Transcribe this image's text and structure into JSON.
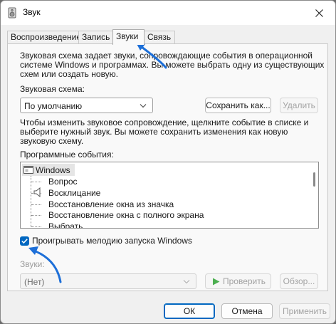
{
  "window": {
    "title": "Звук",
    "close_label": "×"
  },
  "tabs": [
    {
      "label": "Воспроизведение"
    },
    {
      "label": "Запись"
    },
    {
      "label": "Звуки"
    },
    {
      "label": "Связь"
    }
  ],
  "sounds": {
    "description_line1": "Звуковая схема задает звуки, сопровождающие события в операционной",
    "description_line2": "системе Windows и программах. Вы можете выбрать одну из существующих",
    "description_line3": "схем или создать новую.",
    "scheme_label": "Звуковая схема:",
    "scheme_value": "По умолчанию",
    "save_as_label": "Сохранить как...",
    "delete_label": "Удалить",
    "change_line1": "Чтобы изменить звуковое сопровождение, щелкните событие в списке и",
    "change_line2": "выберите нужный звук. Вы можете сохранить изменения как новую",
    "change_line3": "звуковую схему.",
    "events_label": "Программные события:",
    "events": [
      "Windows",
      "Вопрос",
      "Восклицание",
      "Восстановление окна из значка",
      "Восстановление окна с полного экрана",
      "Выбрать"
    ],
    "startup_checkbox_label": "Проигрывать мелодию запуска Windows",
    "sounds_label": "Звуки:",
    "sound_value": "(Нет)",
    "test_label": "Проверить",
    "browse_label": "Обзор..."
  },
  "footer": {
    "ok_label": "ОК",
    "cancel_label": "Отмена",
    "apply_label": "Применить"
  },
  "colors": {
    "accent": "#0067c0",
    "annotation_arrow": "#1d6fd8",
    "play_icon": "#3aa53a"
  }
}
